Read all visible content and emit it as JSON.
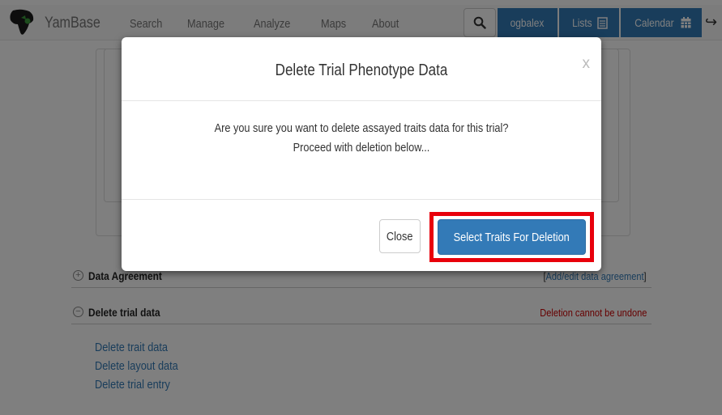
{
  "navbar": {
    "brand": "YamBase",
    "links": [
      "Search",
      "Manage",
      "Analyze",
      "Maps",
      "About"
    ],
    "user": "ogbalex",
    "lists_label": "Lists",
    "calendar_label": "Calendar"
  },
  "sections": {
    "data_agreement": {
      "title": "Data Agreement",
      "link_open": "[",
      "link": "Add/edit data agreement",
      "link_close": "]"
    },
    "delete_trial_data": {
      "title": "Delete trial data",
      "warning": "Deletion cannot be undone",
      "links": [
        "Delete trait data",
        "Delete layout data",
        "Delete trial entry"
      ]
    }
  },
  "modal": {
    "title": "Delete Trial Phenotype Data",
    "close_x": "x",
    "body_line1": "Are you sure you want to delete assayed traits data for this trial?",
    "body_line2": "Proceed with deletion below...",
    "close_button": "Close",
    "confirm_button": "Select Traits For Deletion"
  },
  "colors": {
    "primary": "#337ab7",
    "danger": "#cc0000",
    "highlight": "#e8000b"
  }
}
